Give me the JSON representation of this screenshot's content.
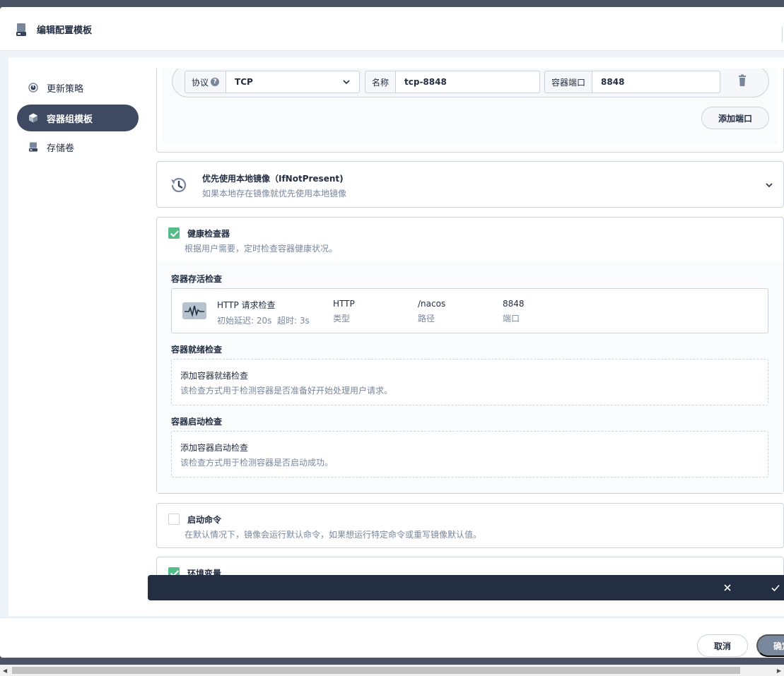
{
  "modal": {
    "title": "编辑配置模板"
  },
  "sidebar": {
    "items": [
      {
        "label": "更新策略",
        "icon": "dashboard-icon",
        "active": false
      },
      {
        "label": "容器组模板",
        "icon": "pod-icon",
        "active": true
      },
      {
        "label": "存储卷",
        "icon": "storage-icon",
        "active": false
      }
    ]
  },
  "ports": {
    "protocol_label": "协议",
    "protocol_value": "TCP",
    "name_label": "名称",
    "name_value": "tcp-8848",
    "port_label": "容器端口",
    "port_value": "8848",
    "add_port_label": "添加端口"
  },
  "pull_policy": {
    "title": "优先使用本地镜像（IfNotPresent)",
    "desc": "如果本地存在镜像就优先使用本地镜像"
  },
  "health": {
    "checked": true,
    "title": "健康检查器",
    "desc": "根据用户需要，定时检查容器健康状况。",
    "liveness": {
      "label": "容器存活检查",
      "probe_title": "HTTP 请求检查",
      "probe_sub": "初始延迟: 20s  超时: 3s",
      "type_value": "HTTP",
      "type_key": "类型",
      "path_value": "/nacos",
      "path_key": "路径",
      "port_value": "8848",
      "port_key": "端口"
    },
    "readiness": {
      "label": "容器就绪检查",
      "add_title": "添加容器就绪检查",
      "add_desc": "该检查方式用于检测容器是否准备好开始处理用户请求。"
    },
    "startup": {
      "label": "容器启动检查",
      "add_title": "添加容器启动检查",
      "add_desc": "该检查方式用于检测容器是否启动成功。"
    }
  },
  "startup_command": {
    "checked": false,
    "title": "启动命令",
    "desc": "在默认情况下，镜像会运行默认命令，如果想运行特定命令或重写镜像默认值。"
  },
  "env": {
    "checked": true,
    "title": "环境变量"
  },
  "footer": {
    "cancel_label": "取消",
    "ok_label": "确定"
  },
  "colors": {
    "dark": "#242e42",
    "accent_green": "#55bc8a",
    "muted": "#79879c"
  }
}
